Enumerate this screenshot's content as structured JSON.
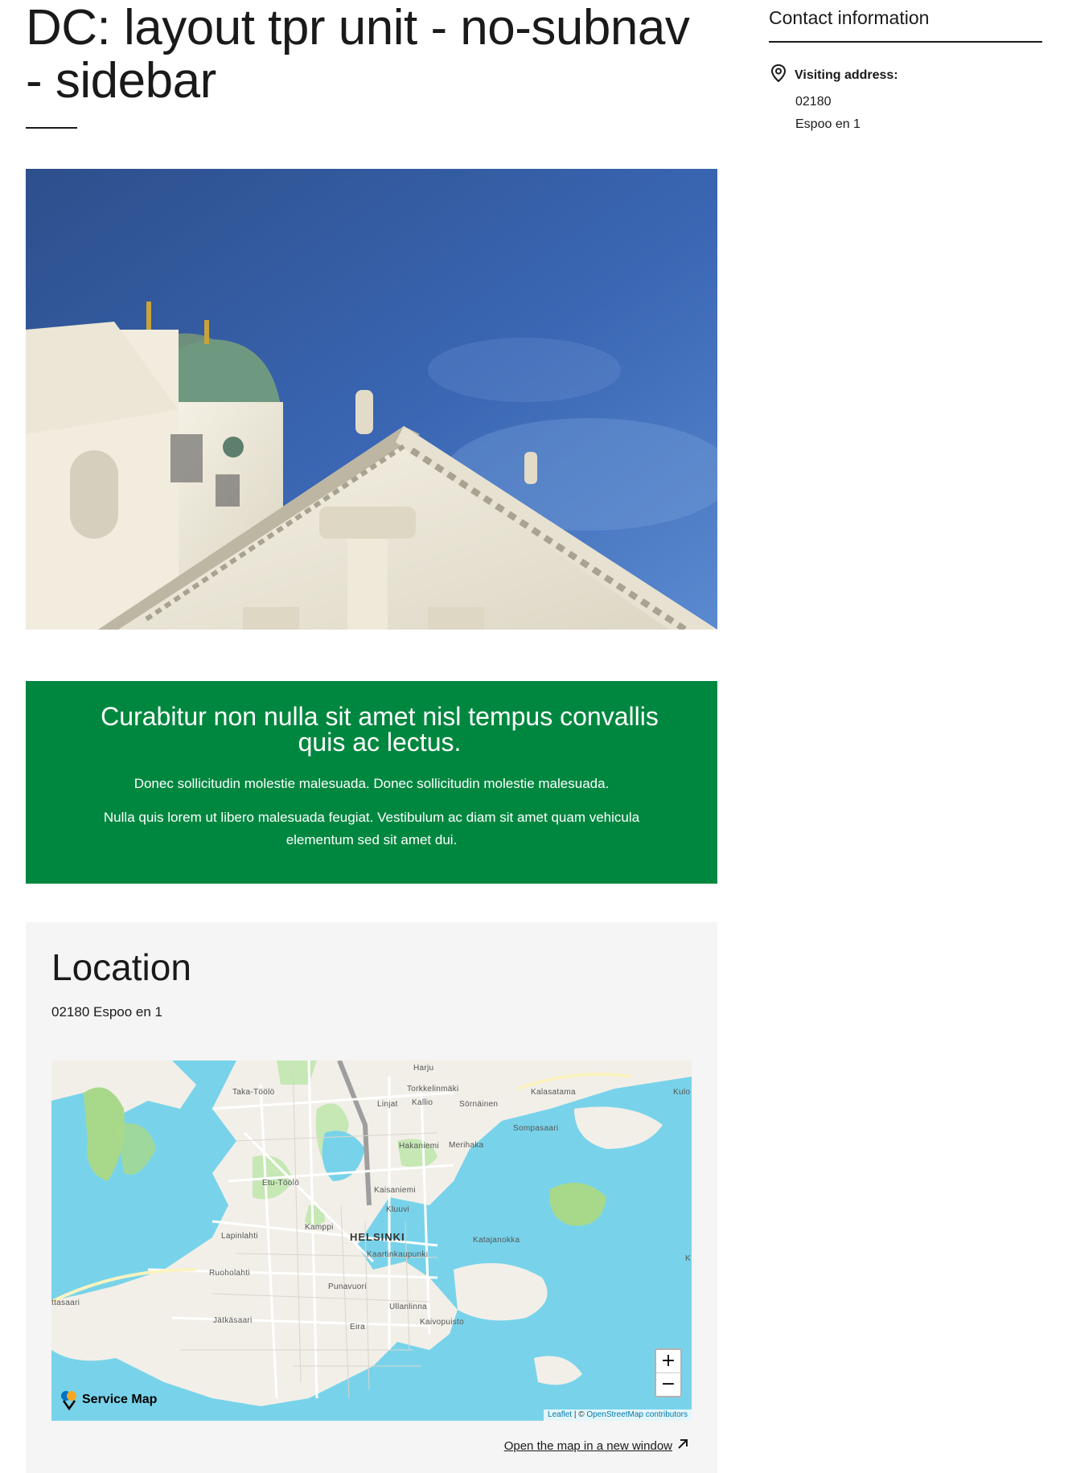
{
  "page": {
    "title": "DC: layout tpr unit - no-subnav - sidebar"
  },
  "banner": {
    "title": "Curabitur non nulla sit amet nisl tempus convallis quis ac lectus.",
    "paragraph_1": "Donec sollicitudin molestie malesuada. Donec sollicitudin molestie malesuada.",
    "paragraph_2": "Nulla quis lorem ut libero malesuada feugiat. Vestibulum ac diam sit amet quam vehicula elementum sed sit amet dui.",
    "color": "#00873f"
  },
  "location": {
    "title": "Location",
    "address": "02180 Espoo en 1",
    "open_map_link": "Open the map in a new window"
  },
  "map": {
    "labels": {
      "harju": "Harju",
      "taka_toolo": "Taka-Töölö",
      "torkkelinmaki": "Torkkelinmäki",
      "linjat": "Linjat",
      "kallio": "Kallio",
      "sornainen": "Sörnäinen",
      "kalasatama": "Kalasatama",
      "kulo": "Kulo",
      "sompasaari": "Sompasaari",
      "hakaniemi": "Hakaniemi",
      "merihaka": "Merihaka",
      "etu_toolo": "Etu-Töölö",
      "kaisaniemi": "Kaisaniemi",
      "kluuvi": "Kluuvi",
      "kamppi": "Kamppi",
      "helsinki": "HELSINKI",
      "katajanokka": "Katajanokka",
      "lapinlahti": "Lapinlahti",
      "kaartinkaupunki": "Kaartinkaupunki",
      "ruoholahti": "Ruoholahti",
      "punavuori": "Punavuori",
      "ttasaari": "ttasaari",
      "ullanlinna": "Ullanlinna",
      "jatkasaari": "Jätkäsaari",
      "kaivopuisto": "Kaivopuisto",
      "eira": "Eira",
      "k": "K"
    },
    "zoom_in": "+",
    "zoom_out": "−",
    "logo_text": "Service Map",
    "attribution_leaflet": "Leaflet",
    "attribution_sep": " | © ",
    "attribution_osm": "OpenStreetMap contributors"
  },
  "sidebar": {
    "contact_title": "Contact information",
    "visiting_label": "Visiting address:",
    "postal_code": "02180",
    "city_line": "Espoo en 1"
  },
  "icons": {
    "location_pin": "location-pin-icon",
    "external_link": "arrow-up-right-icon",
    "map_logo": "service-map-logo-icon"
  }
}
